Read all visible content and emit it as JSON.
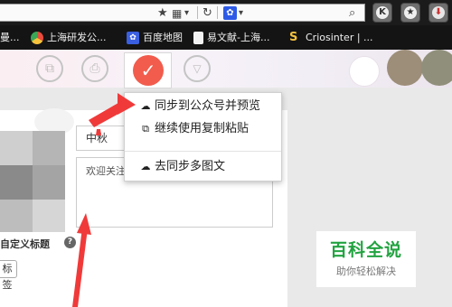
{
  "browser": {
    "bookmarks": [
      {
        "label": "曼...",
        "icon": "partial-bookmark-icon",
        "color": "#555555"
      },
      {
        "label": "上海研发公...",
        "icon": "chrome-favicon-icon",
        "color": "#e94b3c"
      },
      {
        "label": "百度地图",
        "icon": "baidu-paw-icon",
        "color": "#3a5fe0"
      },
      {
        "label": "易文献-上海...",
        "icon": "document-icon",
        "color": "#f2f2f2"
      },
      {
        "label": "Criosinter | ...",
        "icon": "s-logo-icon",
        "color": "#2f7fd6"
      }
    ],
    "toolbar_buttons": [
      {
        "icon": "k-extension-icon",
        "glyph": "K"
      },
      {
        "icon": "star-extension-icon",
        "glyph": "★"
      },
      {
        "icon": "download-icon",
        "glyph": "⬇"
      }
    ]
  },
  "menu": {
    "items": [
      {
        "label": "同步到公众号并预览",
        "icon": "cloud-upload-icon",
        "glyph": "☁"
      },
      {
        "label": "继续使用复制粘贴",
        "icon": "external-link-icon",
        "glyph": "⧉"
      },
      {
        "label": "去同步多图文",
        "icon": "cloud-upload-icon",
        "glyph": "☁"
      }
    ]
  },
  "form": {
    "title_value": "中秋",
    "desc_placeholder": "欢迎关注",
    "custom_title_label": "自定义标题",
    "help_glyph": "?",
    "tag_button_label": "标签"
  },
  "watermark": {
    "title": "百科全说",
    "subtitle": "助你轻松解决"
  },
  "colors": {
    "accent_red": "#f25c4c",
    "watermark_green": "#22a340",
    "annotation_arrow": "#f03a3a"
  }
}
